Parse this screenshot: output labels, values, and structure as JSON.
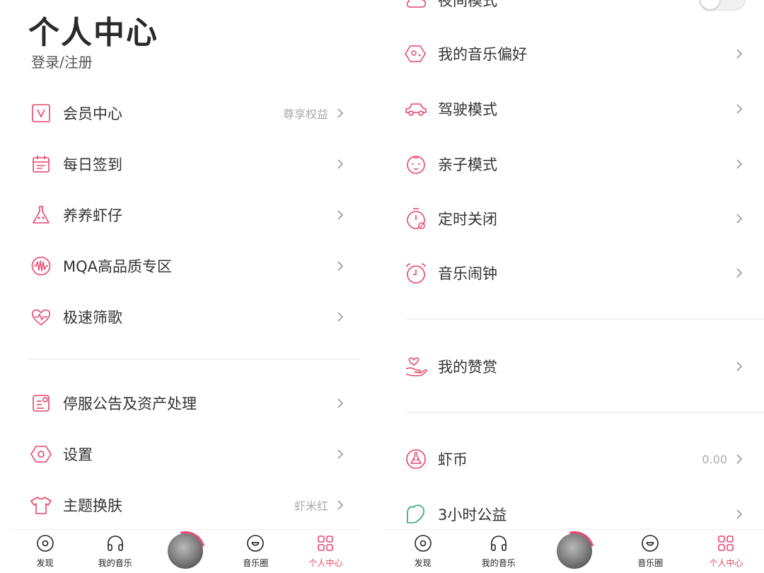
{
  "colors": {
    "accent": "#e8456b",
    "text": "#333333",
    "muted": "#aaaaaa",
    "divider": "#f1f1f1",
    "green": "#2ea56b"
  },
  "left": {
    "title": "个人中心",
    "login": "登录/注册",
    "items": [
      {
        "label": "会员中心",
        "extra": "尊享权益",
        "icon": "vip-icon"
      },
      {
        "label": "每日签到",
        "extra": "",
        "icon": "calendar-icon"
      },
      {
        "label": "养养虾仔",
        "extra": "",
        "icon": "shrimp-icon"
      },
      {
        "label": "MQA高品质专区",
        "extra": "",
        "icon": "mqa-wave-icon"
      },
      {
        "label": "极速筛歌",
        "extra": "",
        "icon": "heart-pulse-icon"
      },
      {
        "label": "停服公告及资产处理",
        "extra": "",
        "icon": "notice-icon"
      },
      {
        "label": "设置",
        "extra": "",
        "icon": "settings-hex-icon"
      },
      {
        "label": "主题换肤",
        "extra": "虾米红",
        "icon": "tshirt-icon"
      }
    ]
  },
  "right": {
    "night_label": "夜间模式",
    "night_mode_on": false,
    "items": [
      {
        "label": "我的音乐偏好",
        "extra": "",
        "icon": "music-preference-icon"
      },
      {
        "label": "驾驶模式",
        "extra": "",
        "icon": "car-icon"
      },
      {
        "label": "亲子模式",
        "extra": "",
        "icon": "baby-face-icon"
      },
      {
        "label": "定时关闭",
        "extra": "",
        "icon": "timer-icon"
      },
      {
        "label": "音乐闹钟",
        "extra": "",
        "icon": "alarm-clock-icon"
      },
      {
        "label": "我的赞赏",
        "extra": "",
        "icon": "appreciation-icon"
      },
      {
        "label": "虾币",
        "extra": "0.00",
        "icon": "shrimp-coin-icon"
      },
      {
        "label": "3小时公益",
        "extra": "",
        "icon": "charity-heart-icon"
      }
    ]
  },
  "tabbar": {
    "tabs": [
      {
        "label": "发现",
        "icon": "discover-icon"
      },
      {
        "label": "我的音乐",
        "icon": "headphones-icon"
      },
      {
        "label": "",
        "icon": "player-disc-icon"
      },
      {
        "label": "音乐圈",
        "icon": "music-circle-icon"
      },
      {
        "label": "个人中心",
        "icon": "grid-icon"
      }
    ],
    "active": "个人中心"
  }
}
